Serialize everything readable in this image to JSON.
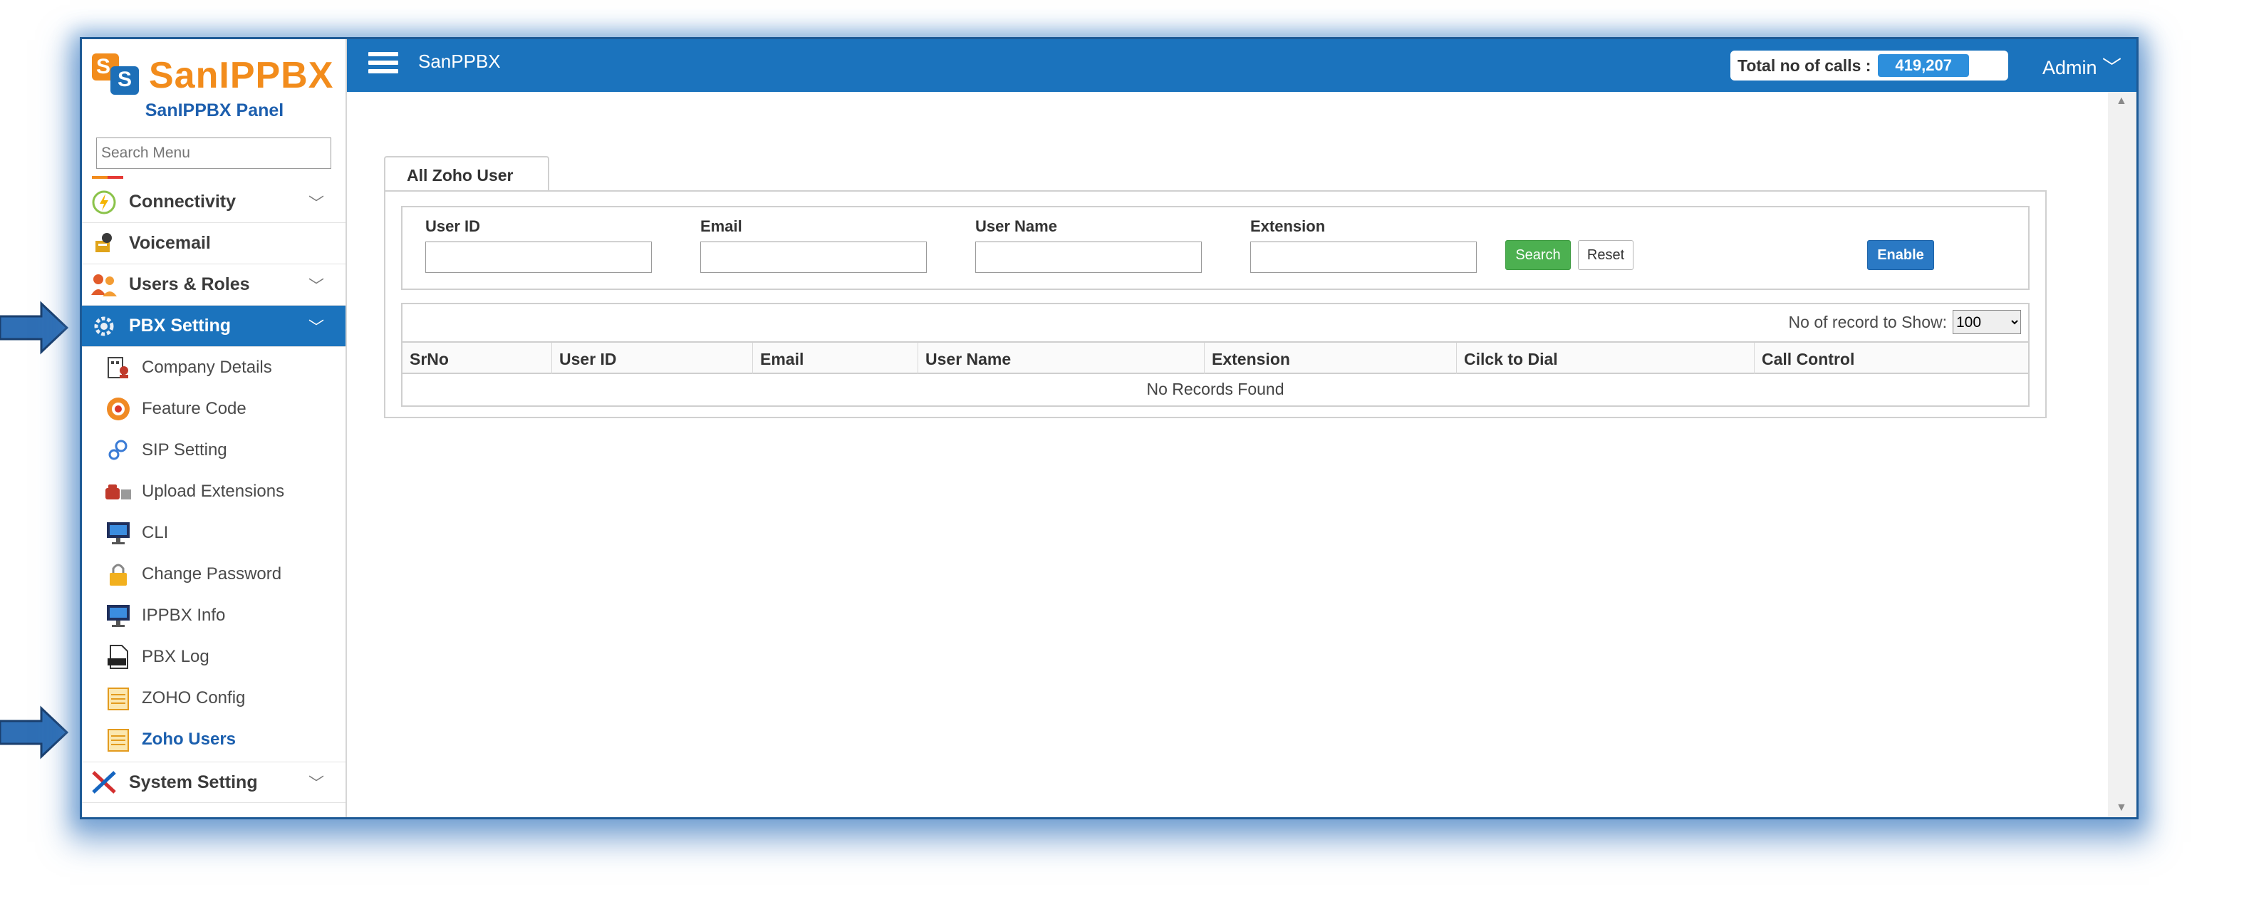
{
  "brand": {
    "logo_text": "SanIPPBX",
    "panel_title": "SanIPPBX Panel"
  },
  "sidebar": {
    "search_placeholder": "Search Menu",
    "items": [
      {
        "label": "Connectivity",
        "icon": "connectivity-icon",
        "has_chevron": true
      },
      {
        "label": "Voicemail",
        "icon": "voicemail-icon",
        "has_chevron": false
      },
      {
        "label": "Users & Roles",
        "icon": "users-icon",
        "has_chevron": true
      },
      {
        "label": "PBX Setting",
        "icon": "gear-icon",
        "has_chevron": true,
        "active": true
      }
    ],
    "subitems": [
      {
        "label": "Company Details",
        "icon": "company-icon"
      },
      {
        "label": "Feature Code",
        "icon": "feature-code-icon"
      },
      {
        "label": "SIP Setting",
        "icon": "sip-settings-icon"
      },
      {
        "label": "Upload Extensions",
        "icon": "upload-icon"
      },
      {
        "label": "CLI",
        "icon": "monitor-icon"
      },
      {
        "label": "Change Password",
        "icon": "lock-icon"
      },
      {
        "label": "IPPBX Info",
        "icon": "monitor-icon"
      },
      {
        "label": "PBX Log",
        "icon": "log-file-icon"
      },
      {
        "label": "ZOHO Config",
        "icon": "notepad-icon"
      },
      {
        "label": "Zoho Users",
        "icon": "notepad-icon",
        "current": true
      }
    ],
    "bottom_item": {
      "label": "System Setting",
      "icon": "tools-icon",
      "has_chevron": true
    }
  },
  "topbar": {
    "title": "SanPPBX",
    "calls_label": "Total no of calls :",
    "calls_value": "419,207",
    "user": "Admin"
  },
  "tab": {
    "label": "All Zoho User"
  },
  "filters": {
    "fields": [
      {
        "label": "User ID",
        "value": ""
      },
      {
        "label": "Email",
        "value": ""
      },
      {
        "label": "User Name",
        "value": ""
      },
      {
        "label": "Extension",
        "value": ""
      }
    ],
    "search_button": "Search",
    "reset_button": "Reset",
    "enable_button": "Enable"
  },
  "table": {
    "records_label": "No of record to Show:",
    "records_value": "100",
    "columns": [
      "SrNo",
      "User ID",
      "Email",
      "User Name",
      "Extension",
      "Cilck to Dial",
      "Call Control"
    ],
    "empty_message": "No Records Found"
  },
  "colors": {
    "primary": "#1b73bd",
    "brand_orange": "#f28c1c",
    "success": "#4cb050",
    "badge": "#2d8fdc"
  }
}
